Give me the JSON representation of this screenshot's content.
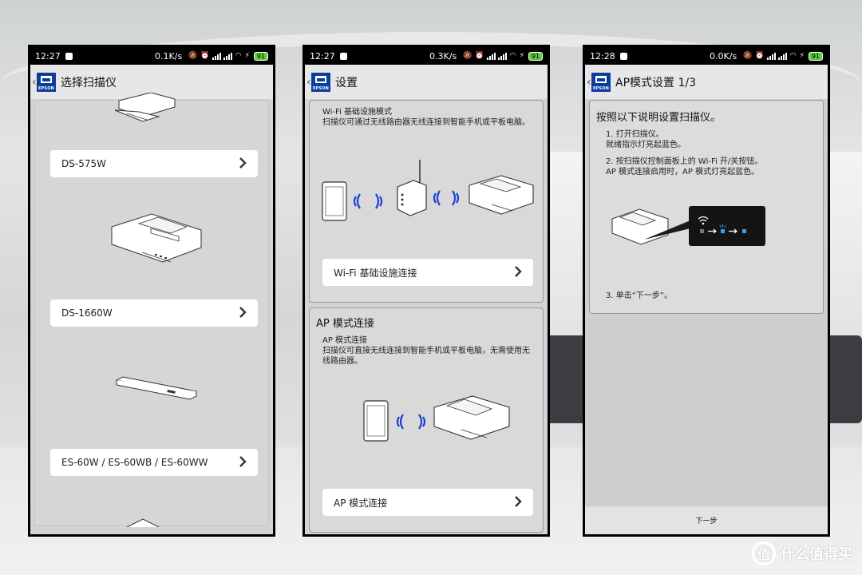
{
  "phones": [
    {
      "status": {
        "time": "12:27",
        "speed": "0.1K/s",
        "battery": "91"
      },
      "title": "选择扫描仪",
      "models": [
        "DS-575W",
        "DS-1660W",
        "ES-60W / ES-60WB / ES-60WW"
      ]
    },
    {
      "status": {
        "time": "12:27",
        "speed": "0.3K/s",
        "battery": "91"
      },
      "title": "设置",
      "wifi_mode": {
        "subtitle": "Wi-Fi 基础设施模式",
        "description": "扫描仪可通过无线路由器无线连接到智能手机或平板电脑。",
        "link": "Wi-Fi 基础设施连接"
      },
      "ap_mode": {
        "heading": "AP 模式连接",
        "subtitle": "AP 模式连接",
        "description": "扫描仪可直接无线连接到智能手机或平板电脑，无需使用无线路由器。",
        "link": "AP 模式连接"
      }
    },
    {
      "status": {
        "time": "12:28",
        "speed": "0.0K/s",
        "battery": "91"
      },
      "title": "AP模式设置 1/3",
      "instruction_heading": "按照以下说明设置扫描仪。",
      "step1a": "1. 打开扫描仪。",
      "step1b": "就绪指示灯亮起蓝色。",
      "step2a": "2. 按扫描仪控制面板上的 Wi-Fi 开/关按钮。",
      "step2b": "AP 模式连接启用时，AP 模式灯亮起蓝色。",
      "step3": "3. 单击“下一步”。",
      "next": "下一步"
    }
  ],
  "logo_word": "EPSON",
  "watermark": "什么值得买",
  "colors": {
    "epson_blue": "#0b3e9c",
    "battery_green": "#5fce3a",
    "wave_blue": "#1a3fd6",
    "panel_blue": "#3aa0e8"
  }
}
